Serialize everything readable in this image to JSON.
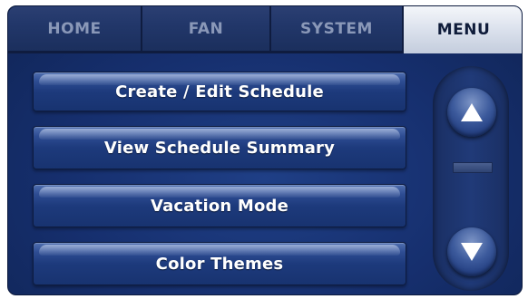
{
  "tabs": [
    {
      "label": "HOME",
      "active": false
    },
    {
      "label": "FAN",
      "active": false
    },
    {
      "label": "SYSTEM",
      "active": false
    },
    {
      "label": "MENU",
      "active": true
    }
  ],
  "menu": {
    "items": [
      {
        "label": "Create / Edit Schedule"
      },
      {
        "label": "View Schedule Summary"
      },
      {
        "label": "Vacation Mode"
      },
      {
        "label": "Color Themes"
      }
    ]
  },
  "scroll": {
    "up_icon": "triangle-up-icon",
    "down_icon": "triangle-down-icon"
  },
  "colors": {
    "background": "#1a3373",
    "active_tab": "#dde3ee",
    "inactive_tab_text": "#8a98b8",
    "button_text": "#ffffff"
  }
}
